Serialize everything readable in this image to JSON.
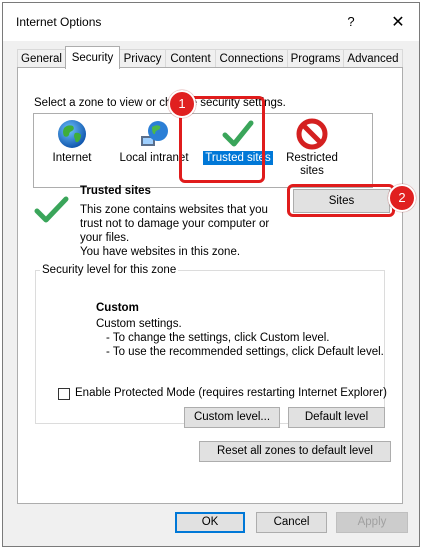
{
  "window": {
    "title": "Internet Options",
    "help_label": "?",
    "close_label": "✕"
  },
  "tabs": [
    {
      "label": "General"
    },
    {
      "label": "Security",
      "active": true
    },
    {
      "label": "Privacy"
    },
    {
      "label": "Content"
    },
    {
      "label": "Connections"
    },
    {
      "label": "Programs"
    },
    {
      "label": "Advanced"
    }
  ],
  "security": {
    "zone_caption": "Select a zone to view or change security settings.",
    "zones": [
      {
        "label": "Internet",
        "icon": "globe-icon"
      },
      {
        "label": "Local intranet",
        "icon": "network-globe-icon"
      },
      {
        "label": "Trusted sites",
        "icon": "checkmark-icon",
        "selected": true
      },
      {
        "label": "Restricted sites",
        "icon": "prohibited-icon"
      }
    ],
    "zone_title": "Trusted sites",
    "zone_description": [
      "This zone contains websites that you",
      "trust not to damage your computer or",
      "your files.",
      "You have websites in this zone."
    ],
    "sites_button": "Sites",
    "level_legend": "Security level for this zone",
    "level_title": "Custom",
    "level_lines": [
      "Custom settings.",
      "- To change the settings, click Custom level.",
      "- To use the recommended settings, click Default level."
    ],
    "protected_mode_label": "Enable Protected Mode (requires restarting Internet Explorer)",
    "protected_mode_checked": false,
    "custom_level_button": "Custom level...",
    "default_level_button": "Default level",
    "reset_button": "Reset all zones to default level"
  },
  "annotations": {
    "badge_1": "1",
    "badge_2": "2",
    "color": "#e01c1c"
  },
  "footer": {
    "ok_label": "OK",
    "cancel_label": "Cancel",
    "apply_label": "Apply"
  },
  "colors": {
    "selection": "#0078d7",
    "panel": "#ffffff",
    "chrome": "#f0f0f0"
  }
}
